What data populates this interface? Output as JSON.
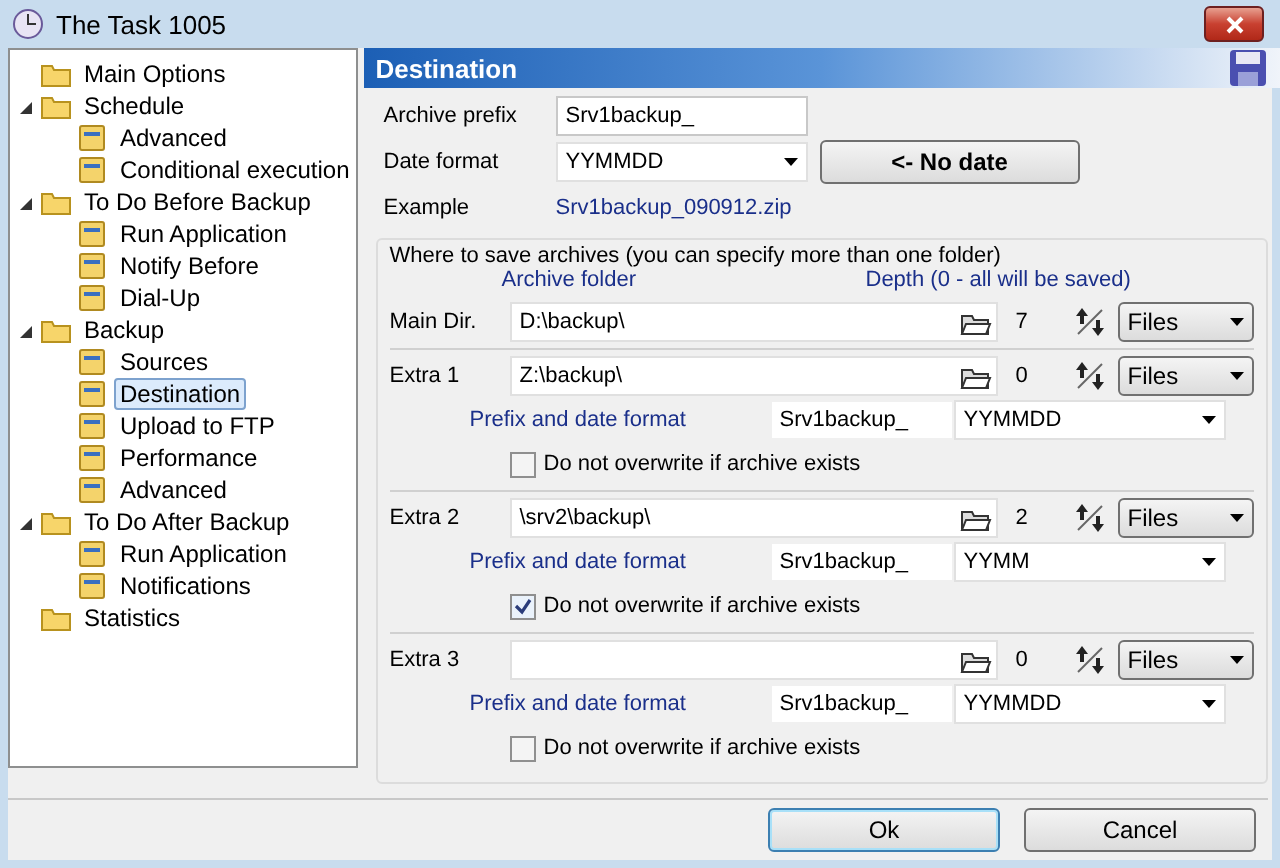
{
  "window": {
    "title": "The Task 1005"
  },
  "tree": [
    {
      "label": "Main Options",
      "selected": false
    },
    {
      "label": "Schedule",
      "selected": false,
      "expanded": true,
      "children": [
        {
          "label": "Advanced",
          "selected": false
        },
        {
          "label": "Conditional execution",
          "selected": false
        }
      ]
    },
    {
      "label": "To Do Before Backup",
      "selected": false,
      "expanded": true,
      "children": [
        {
          "label": "Run Application",
          "selected": false
        },
        {
          "label": "Notify Before",
          "selected": false
        },
        {
          "label": "Dial-Up",
          "selected": false
        }
      ]
    },
    {
      "label": "Backup",
      "selected": false,
      "expanded": true,
      "children": [
        {
          "label": "Sources",
          "selected": false
        },
        {
          "label": "Destination",
          "selected": true
        },
        {
          "label": "Upload to FTP",
          "selected": false
        },
        {
          "label": "Performance",
          "selected": false
        },
        {
          "label": "Advanced",
          "selected": false
        }
      ]
    },
    {
      "label": "To Do After Backup",
      "selected": false,
      "expanded": true,
      "children": [
        {
          "label": "Run Application",
          "selected": false
        },
        {
          "label": "Notifications",
          "selected": false
        }
      ]
    },
    {
      "label": "Statistics",
      "selected": false
    }
  ],
  "panel": {
    "title": "Destination"
  },
  "archive_prefix": {
    "label": "Archive prefix",
    "value": "Srv1backup_"
  },
  "date_format": {
    "label": "Date format",
    "value": "YYMMDD"
  },
  "no_date_button": "<- No date",
  "example": {
    "label": "Example",
    "value": "Srv1backup_090912.zip"
  },
  "locations": {
    "title": "Where to save archives (you can specify more than one folder)",
    "folder_header": "Archive folder",
    "depth_header": "Depth (0 - all will be saved)",
    "main": {
      "label": "Main Dir.",
      "folder": "D:\\backup\\",
      "depth": "7",
      "unit": "Files"
    },
    "extras": [
      {
        "label": "Extra 1",
        "folder": "Z:\\backup\\",
        "depth": "0",
        "unit": "Files",
        "prefix_label": "Prefix and date format",
        "prefix": "Srv1backup_",
        "date_format": "YYMMDD",
        "no_overwrite_label": "Do not overwrite if archive exists",
        "no_overwrite": false
      },
      {
        "label": "Extra 2",
        "folder": "\\srv2\\backup\\",
        "depth": "2",
        "unit": "Files",
        "prefix_label": "Prefix and date format",
        "prefix": "Srv1backup_",
        "date_format": "YYMM",
        "no_overwrite_label": "Do not overwrite if archive exists",
        "no_overwrite": true
      },
      {
        "label": "Extra 3",
        "depth": "0",
        "unit": "Files",
        "prefix_label": "Prefix and date format",
        "prefix": "Srv1backup_",
        "date_format": "YYMMDD",
        "no_overwrite_label": "Do not overwrite if archive exists",
        "no_overwrite": false
      }
    ]
  },
  "buttons": [
    {
      "label": "Ok",
      "default": true
    },
    {
      "label": "Cancel",
      "default": false
    }
  ]
}
